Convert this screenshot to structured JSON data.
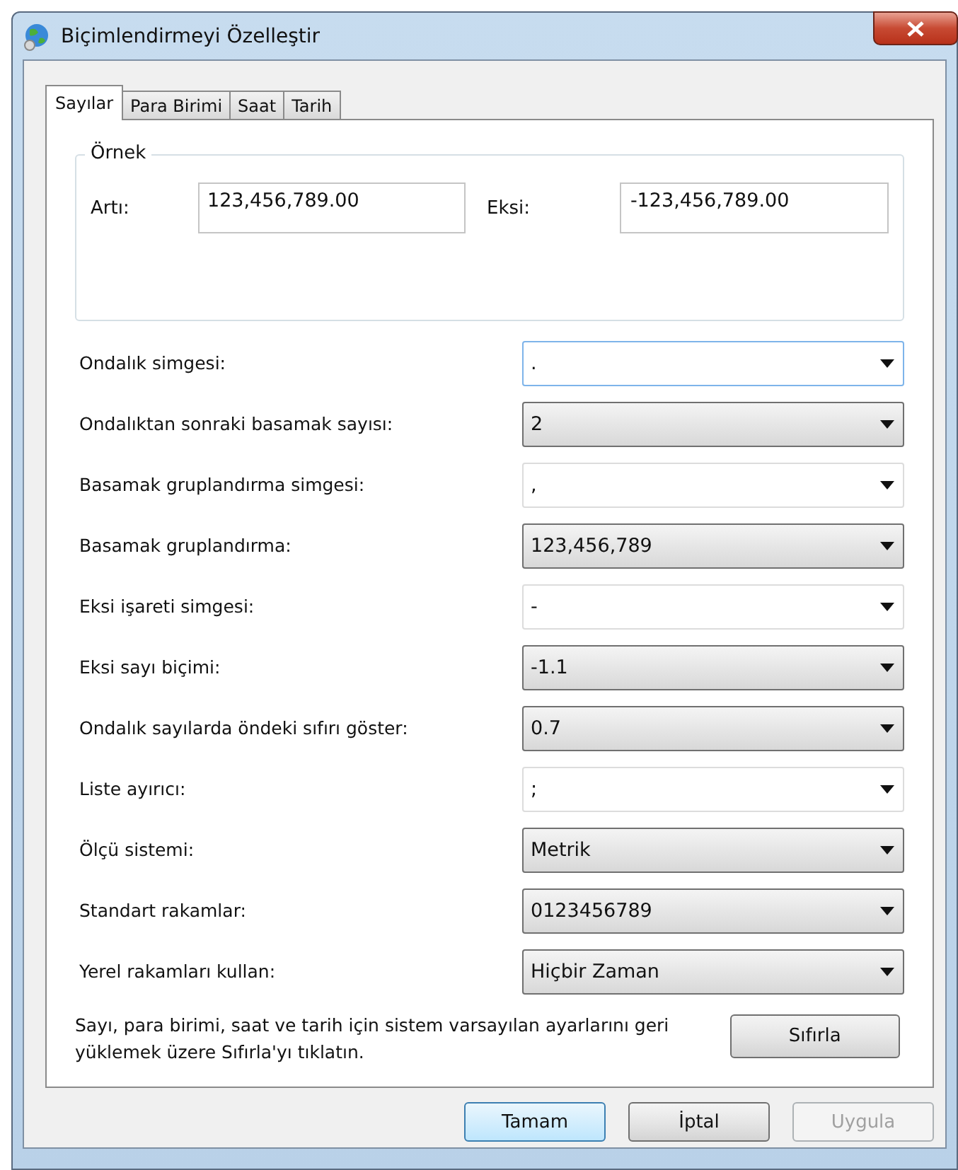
{
  "window": {
    "title": "Biçimlendirmeyi Özelleştir"
  },
  "tabs": [
    {
      "label": "Sayılar",
      "selected": true
    },
    {
      "label": "Para Birimi",
      "selected": false
    },
    {
      "label": "Saat",
      "selected": false
    },
    {
      "label": "Tarih",
      "selected": false
    }
  ],
  "sample": {
    "title": "Örnek",
    "positive_label": "Artı:",
    "positive_value": "123,456,789.00",
    "negative_label": "Eksi:",
    "negative_value": "-123,456,789.00"
  },
  "settings": [
    {
      "label": "Ondalık simgesi:",
      "value": ".",
      "kind": "editable",
      "focused": true
    },
    {
      "label": "Ondalıktan sonraki basamak sayısı:",
      "value": "2",
      "kind": "dropdown",
      "focused": false
    },
    {
      "label": "Basamak gruplandırma simgesi:",
      "value": ",",
      "kind": "editable",
      "focused": false
    },
    {
      "label": "Basamak gruplandırma:",
      "value": "123,456,789",
      "kind": "dropdown",
      "focused": false
    },
    {
      "label": "Eksi işareti simgesi:",
      "value": "-",
      "kind": "editable",
      "focused": false
    },
    {
      "label": "Eksi sayı biçimi:",
      "value": "-1.1",
      "kind": "dropdown",
      "focused": false
    },
    {
      "label": "Ondalık sayılarda öndeki sıfırı göster:",
      "value": "0.7",
      "kind": "dropdown",
      "focused": false
    },
    {
      "label": "Liste ayırıcı:",
      "value": ";",
      "kind": "editable",
      "focused": false
    },
    {
      "label": "Ölçü sistemi:",
      "value": "Metrik",
      "kind": "dropdown",
      "focused": false
    },
    {
      "label": "Standart rakamlar:",
      "value": "0123456789",
      "kind": "dropdown",
      "focused": false
    },
    {
      "label": "Yerel rakamları kullan:",
      "value": "Hiçbir Zaman",
      "kind": "dropdown",
      "focused": false
    }
  ],
  "reset": {
    "text": "Sayı, para birimi, saat ve tarih için sistem varsayılan ayarlarını geri yüklemek üzere Sıfırla'yı tıklatın.",
    "button": "Sıfırla"
  },
  "buttons": [
    {
      "label": "Tamam",
      "default": true,
      "disabled": false
    },
    {
      "label": "İptal",
      "default": false,
      "disabled": false
    },
    {
      "label": "Uygula",
      "default": false,
      "disabled": true
    }
  ]
}
